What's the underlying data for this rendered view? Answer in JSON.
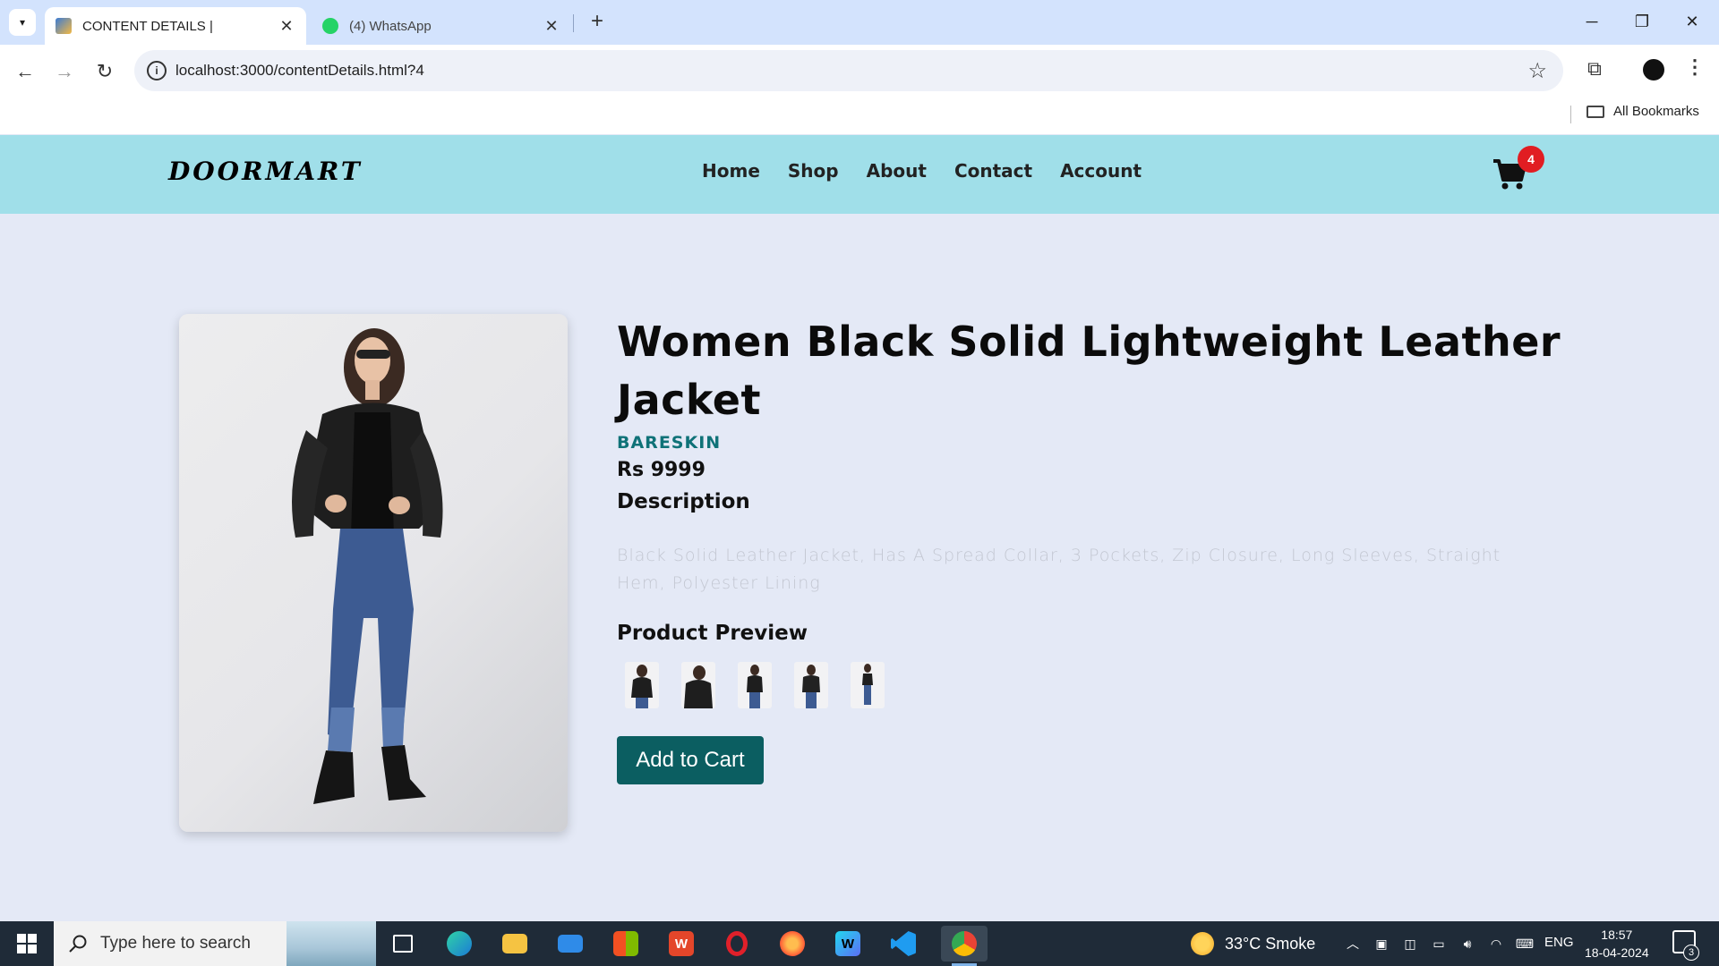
{
  "browser": {
    "tabs": [
      {
        "title": "CONTENT DETAILS |",
        "active": true
      },
      {
        "title": "(4) WhatsApp",
        "active": false
      }
    ],
    "url": "localhost:3000/contentDetails.html?4",
    "bookmarks_label": "All Bookmarks",
    "window_controls": {
      "minimize": "─",
      "restore": "❐",
      "close": "✕"
    }
  },
  "site": {
    "logo": "DOORMART",
    "nav": [
      "Home",
      "Shop",
      "About",
      "Contact",
      "Account"
    ],
    "cart_count": "4"
  },
  "product": {
    "title": "Women Black Solid Lightweight Leather Jacket",
    "brand": "BARESKIN",
    "price": "Rs 9999",
    "description_heading": "Description",
    "description": "Black Solid Leather Jacket, Has A Spread Collar, 3 Pockets, Zip Closure, Long Sleeves, Straight Hem, Polyester Lining",
    "preview_heading": "Product Preview",
    "preview_thumbnails": 5,
    "add_to_cart_label": "Add to Cart"
  },
  "taskbar": {
    "search_placeholder": "Type here to search",
    "weather": "33°C  Smoke",
    "language": "ENG",
    "time": "18:57",
    "date": "18-04-2024",
    "notifications": "3",
    "apps": [
      "task-view-icon",
      "edge-icon",
      "file-explorer-icon",
      "mail-icon",
      "store-icon",
      "wps-office-icon",
      "opera-icon",
      "firefox-icon",
      "webstorm-icon",
      "vscode-icon",
      "chrome-icon"
    ]
  },
  "colors": {
    "header_bg": "#a0dfe9",
    "page_bg": "#e4e9f6",
    "brand_text": "#0f7278",
    "button_bg": "#0b5e61",
    "badge": "#e11d22"
  }
}
